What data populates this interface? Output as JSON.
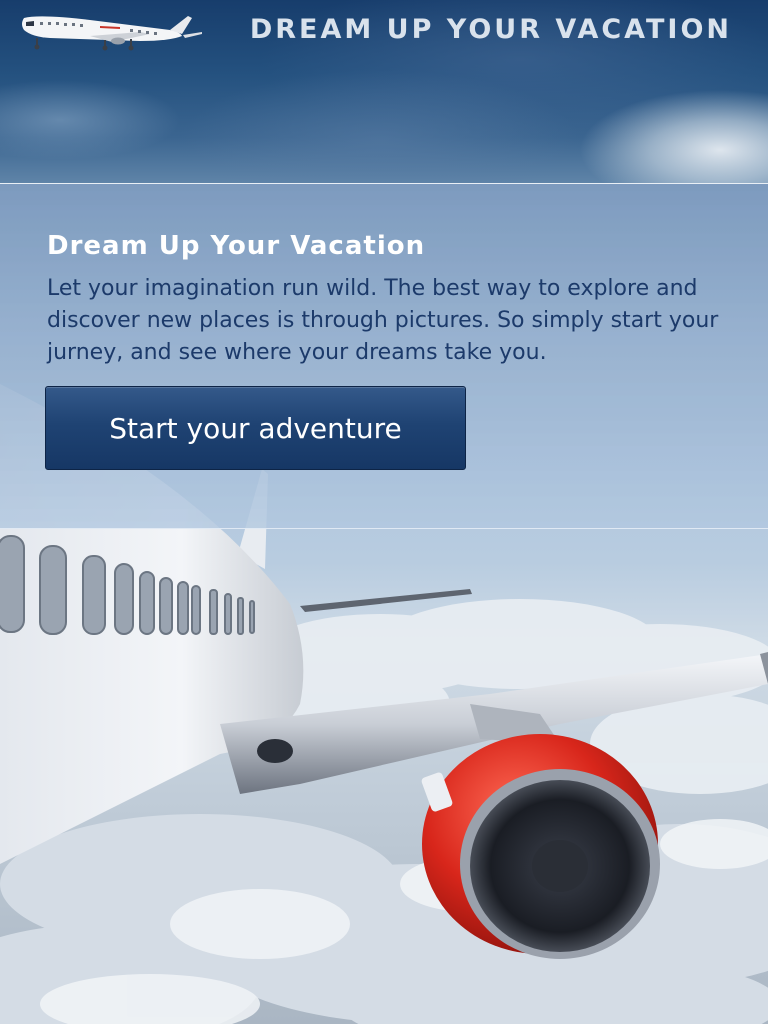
{
  "header": {
    "title": "DREAM UP YOUR VACATION",
    "logo_icon": "airplane-icon"
  },
  "info": {
    "heading": "Dream Up Your Vacation",
    "body": "Let your imagination run wild. The best way to explore and discover new places is through pictures. So simply start your jurney, and see where your dreams take you.",
    "button_label": "Start your adventure"
  },
  "hero": {
    "icon": "airplane-wing-photo"
  },
  "colors": {
    "header_sky": "#24517f",
    "heading_text": "#ffffff",
    "body_text": "#1c3a6a",
    "button_bg": "#1f4373",
    "engine_red": "#d8261b"
  }
}
